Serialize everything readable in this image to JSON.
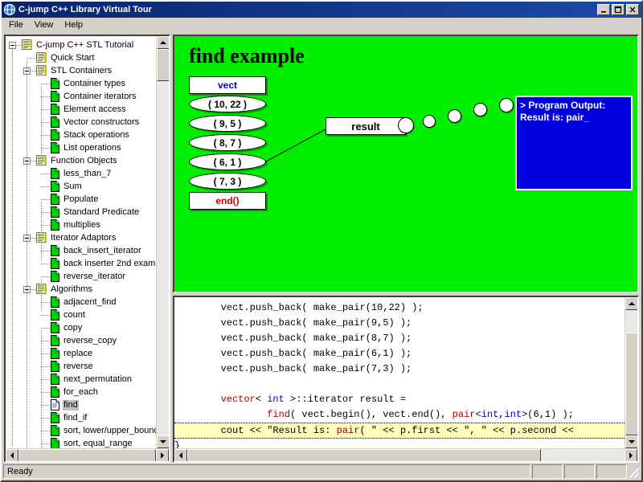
{
  "window": {
    "title": "C-jump C++ Library Virtual Tour",
    "icon": "app-globe-icon",
    "minimize_label": "_",
    "maximize_label": "□",
    "close_label": "✕"
  },
  "menu": {
    "items": [
      {
        "label": "File"
      },
      {
        "label": "View"
      },
      {
        "label": "Help"
      }
    ]
  },
  "tree": {
    "nodes": [
      {
        "label": "C-jump C++ STL Tutorial",
        "depth": 0,
        "type": "book",
        "expander": "minus",
        "selected": false
      },
      {
        "label": "Quick Start",
        "depth": 1,
        "type": "book",
        "expander": "none",
        "selected": false
      },
      {
        "label": "STL Containers",
        "depth": 1,
        "type": "book",
        "expander": "minus",
        "selected": false
      },
      {
        "label": "Container types",
        "depth": 2,
        "type": "page",
        "expander": "none",
        "selected": false
      },
      {
        "label": "Container iterators",
        "depth": 2,
        "type": "page",
        "expander": "none",
        "selected": false
      },
      {
        "label": "Element access",
        "depth": 2,
        "type": "page",
        "expander": "none",
        "selected": false
      },
      {
        "label": "Vector constructors",
        "depth": 2,
        "type": "page",
        "expander": "none",
        "selected": false
      },
      {
        "label": "Stack operations",
        "depth": 2,
        "type": "page",
        "expander": "none",
        "selected": false
      },
      {
        "label": "List operations",
        "depth": 2,
        "type": "page",
        "expander": "none",
        "selected": false
      },
      {
        "label": "Function Objects",
        "depth": 1,
        "type": "book",
        "expander": "minus",
        "selected": false
      },
      {
        "label": "less_than_7",
        "depth": 2,
        "type": "page",
        "expander": "none",
        "selected": false
      },
      {
        "label": "Sum",
        "depth": 2,
        "type": "page",
        "expander": "none",
        "selected": false
      },
      {
        "label": "Populate",
        "depth": 2,
        "type": "page",
        "expander": "none",
        "selected": false
      },
      {
        "label": "Standard Predicate",
        "depth": 2,
        "type": "page",
        "expander": "none",
        "selected": false
      },
      {
        "label": "multiplies",
        "depth": 2,
        "type": "page",
        "expander": "none",
        "selected": false
      },
      {
        "label": "Iterator Adaptors",
        "depth": 1,
        "type": "book",
        "expander": "minus",
        "selected": false
      },
      {
        "label": "back_insert_iterator",
        "depth": 2,
        "type": "page",
        "expander": "none",
        "selected": false
      },
      {
        "label": "back inserter 2nd exam",
        "depth": 2,
        "type": "page",
        "expander": "none",
        "selected": false
      },
      {
        "label": "reverse_iterator",
        "depth": 2,
        "type": "page",
        "expander": "none",
        "selected": false
      },
      {
        "label": "Algorithms",
        "depth": 1,
        "type": "book",
        "expander": "minus",
        "selected": false
      },
      {
        "label": "adjacent_find",
        "depth": 2,
        "type": "page",
        "expander": "none",
        "selected": false
      },
      {
        "label": "count",
        "depth": 2,
        "type": "page",
        "expander": "none",
        "selected": false
      },
      {
        "label": "copy",
        "depth": 2,
        "type": "page",
        "expander": "none",
        "selected": false
      },
      {
        "label": "reverse_copy",
        "depth": 2,
        "type": "page",
        "expander": "none",
        "selected": false
      },
      {
        "label": "replace",
        "depth": 2,
        "type": "page",
        "expander": "none",
        "selected": false
      },
      {
        "label": "reverse",
        "depth": 2,
        "type": "page",
        "expander": "none",
        "selected": false
      },
      {
        "label": "next_permutation",
        "depth": 2,
        "type": "page",
        "expander": "none",
        "selected": false
      },
      {
        "label": "for_each",
        "depth": 2,
        "type": "page",
        "expander": "none",
        "selected": false
      },
      {
        "label": "find",
        "depth": 2,
        "type": "page-open",
        "expander": "none",
        "selected": true
      },
      {
        "label": "find_if",
        "depth": 2,
        "type": "page",
        "expander": "none",
        "selected": false
      },
      {
        "label": "sort, lower/upper_bound",
        "depth": 2,
        "type": "page",
        "expander": "none",
        "selected": false
      },
      {
        "label": "sort, equal_range",
        "depth": 2,
        "type": "page",
        "expander": "none",
        "selected": false
      }
    ]
  },
  "diagram": {
    "title": "find example",
    "vector_header": "vect",
    "vector_footer": "end()",
    "elements": [
      "( 10, 22 )",
      "( 9, 5 )",
      "( 8, 7 )",
      "( 6, 1 )",
      "( 7, 3 )"
    ],
    "result_label": "result",
    "background_color": "#00ee00",
    "header_color": "#0000cc",
    "footer_color": "#cc0000"
  },
  "output": {
    "line1": "> Program Output:",
    "line2": "Result is: pair_",
    "background_color": "#0000dd",
    "text_color": "#ffffff"
  },
  "code": {
    "lines": [
      {
        "id": "l1",
        "text": "        vect.push_back( make_pair(10,22) );",
        "highlight": false
      },
      {
        "id": "l2",
        "text": "        vect.push_back( make_pair(9,5) );",
        "highlight": false
      },
      {
        "id": "l3",
        "text": "        vect.push_back( make_pair(8,7) );",
        "highlight": false
      },
      {
        "id": "l4",
        "text": "        vect.push_back( make_pair(6,1) );",
        "highlight": false
      },
      {
        "id": "l5",
        "text": "        vect.push_back( make_pair(7,3) );",
        "highlight": false
      },
      {
        "id": "l6",
        "text": "",
        "highlight": false
      },
      {
        "id": "l7",
        "text": "        vector< int >::iterator result =",
        "highlight": false
      },
      {
        "id": "l8",
        "text": "                find( vect.begin(), vect.end(), pair<int,int>(6,1) );",
        "highlight": false
      },
      {
        "id": "l9",
        "text": "        cout << \"Result is: pair( \" << p.first << \", \" << p.second << ",
        "highlight": true
      },
      {
        "id": "l10",
        "text": "}",
        "highlight": false
      }
    ]
  },
  "status": {
    "message": "Ready"
  }
}
